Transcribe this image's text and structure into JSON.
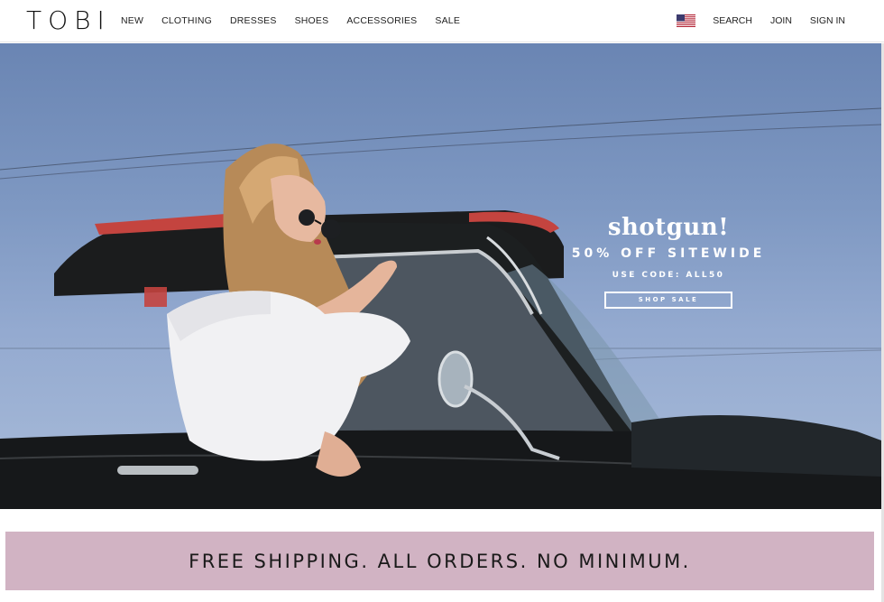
{
  "header": {
    "logo": "TOBI",
    "nav": [
      "NEW",
      "CLOTHING",
      "DRESSES",
      "SHOES",
      "ACCESSORIES",
      "SALE"
    ],
    "right": {
      "flag_icon": "us-flag-icon",
      "search": "SEARCH",
      "join": "JOIN",
      "sign_in": "SIGN IN"
    }
  },
  "hero": {
    "script_title": "shotgun!",
    "headline": "50% OFF SITEWIDE",
    "code_line": "USE CODE: ALL50",
    "button_label": "SHOP SALE"
  },
  "shipping_banner": {
    "text": "FREE SHIPPING. ALL ORDERS. NO MINIMUM."
  },
  "colors": {
    "banner_bg": "#d1b3c3",
    "sky": "#7e98c2",
    "truck_red": "#c4443f"
  }
}
